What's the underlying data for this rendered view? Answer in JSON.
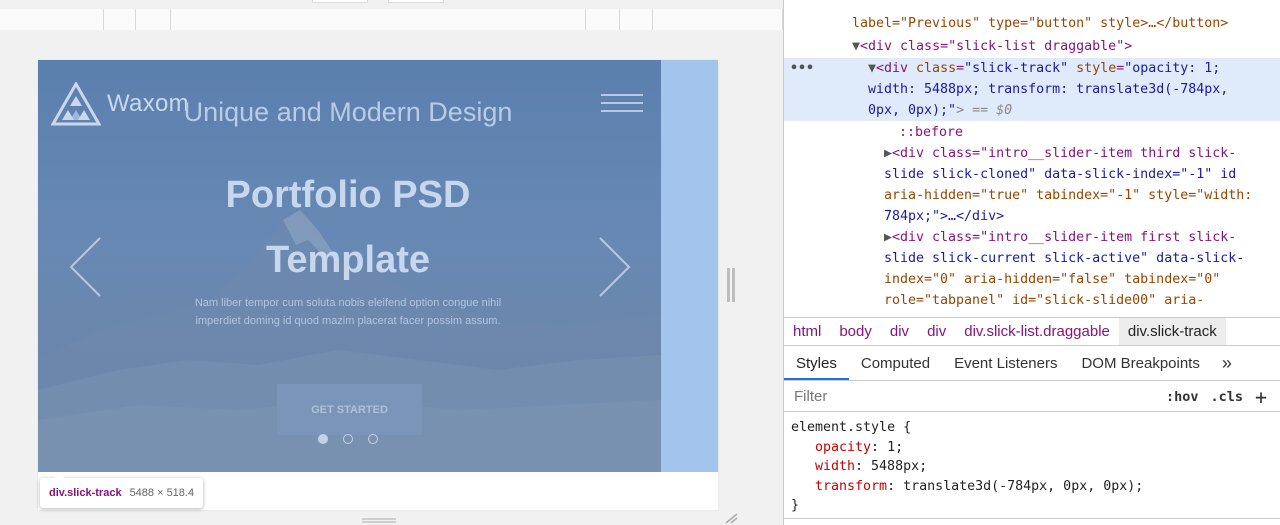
{
  "preview": {
    "logo_text": "Waxom",
    "subtitle": "Unique and Modern Design",
    "title_line1": "Portfolio PSD",
    "title_line2": "Template",
    "description": "Nam liber tempor cum soluta nobis eleifend option congue nihil imperdiet doming id quod mazim placerat facer possim assum.",
    "cta_label": "GET STARTED",
    "dots": [
      true,
      false,
      false
    ]
  },
  "tooltip": {
    "name": "div.slick-track",
    "size": "5488 × 518.4"
  },
  "elements": {
    "line0": "label=\"Previous\" type=\"button\" style>…</button>",
    "line1_tag": "<div class=\"slick-list draggable\">",
    "selected_line1_pre": "<div ",
    "selected_line1_attr1": "class",
    "selected_line1_val1": "\"slick-track\"",
    "selected_line1_attr2": " style",
    "selected_line1_val2": "\"opacity: 1;",
    "selected_line2": "width: 5488px; transform: translate3d(-784px,",
    "selected_line3": "0px, 0px);\"",
    "selected_line3_tail": "> == $0",
    "before": "::before",
    "child1_l1": "<div class=\"intro__slider-item third slick-",
    "child1_l2": "slide slick-cloned\" data-slick-index=\"-1\" id",
    "child1_l3": "aria-hidden=\"true\" tabindex=\"-1\" style=\"width:",
    "child1_l4": "784px;\">…</div>",
    "child2_l1": "<div class=\"intro__slider-item first slick-",
    "child2_l2": "slide slick-current slick-active\" data-slick-",
    "child2_l3": "index=\"0\" aria-hidden=\"false\" tabindex=\"0\"",
    "child2_l4": "role=\"tabpanel\" id=\"slick-slide00\" aria-"
  },
  "breadcrumbs": [
    "html",
    "body",
    "div",
    "div",
    "div.slick-list.draggable",
    "div.slick-track"
  ],
  "tabs": [
    "Styles",
    "Computed",
    "Event Listeners",
    "DOM Breakpoints",
    "»"
  ],
  "filter": {
    "placeholder": "Filter",
    "hov": ":hov",
    "cls": ".cls",
    "add": "+"
  },
  "style_rule": {
    "selector": "element.style {",
    "props": [
      {
        "name": "opacity",
        "value": "1;"
      },
      {
        "name": "width",
        "value": "5488px;"
      },
      {
        "name": "transform",
        "value": "translate3d(-784px, 0px, 0px);"
      }
    ],
    "close": "}"
  },
  "colors": {
    "highlight": "#a3c4ec",
    "tag": "#881280",
    "attr": "#994500",
    "value": "#1a1aa6",
    "css_prop": "#c80000"
  }
}
